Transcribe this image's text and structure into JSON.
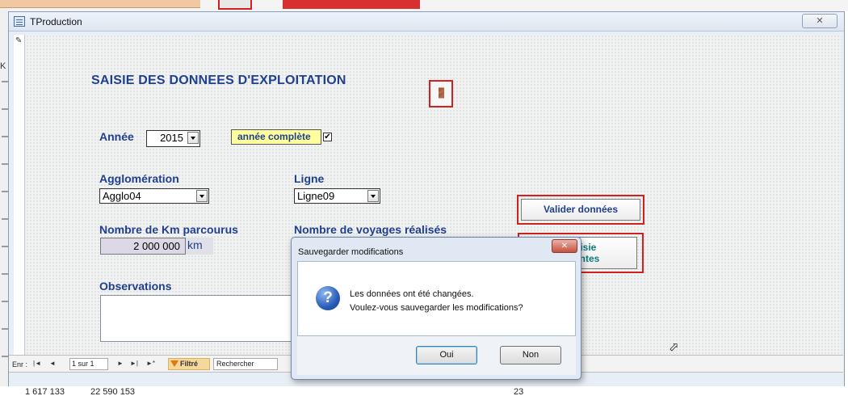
{
  "window": {
    "title": "TProduction",
    "close_glyph": "✕"
  },
  "background": {
    "left_strip_letter": "K"
  },
  "form": {
    "heading": "SAISIE DES DONNEES D'EXPLOITATION",
    "exit_icon": "exit-door-icon",
    "year_label": "Année",
    "year_value": "2015",
    "annee_complete_label": "année complète",
    "annee_complete_checked": true,
    "checkbox_glyph": "✔",
    "agglomeration_label": "Agglomération",
    "agglomeration_value": "Agglo04",
    "ligne_label": "Ligne",
    "ligne_value": "Ligne09",
    "km_label": "Nombre de Km parcourus",
    "km_value": "2 000 000",
    "km_unit": "km",
    "voyages_label": "Nombre de voyages réalisés",
    "observations_label": "Observations",
    "valider_button": "Valider données",
    "next_button_line1": "t saisie",
    "next_button_line2": "uivantes"
  },
  "navbar": {
    "label": "Enr :",
    "first": "|◄",
    "prev": "◄",
    "record": "1 sur 1",
    "next": "►",
    "last": "►|",
    "new": "►*",
    "filter": "Filtré",
    "search_placeholder": "Rechercher"
  },
  "bottom_row": {
    "value1": "1 617 133",
    "value2": "22 590 153",
    "value3": "23"
  },
  "dialog": {
    "title": "Sauvegarder modifications",
    "close_glyph": "✕",
    "icon": "question-icon",
    "icon_glyph": "?",
    "message_line1": "Les données ont été changées.",
    "message_line2": "Voulez-vous sauvegarder les modifications?",
    "yes_button": "Oui",
    "no_button": "Non"
  },
  "colors": {
    "label_blue": "#1f3f8f",
    "highlight_red": "#d02020",
    "teal_button_text": "#0c7a80",
    "yellow_field": "#ffff9e"
  }
}
